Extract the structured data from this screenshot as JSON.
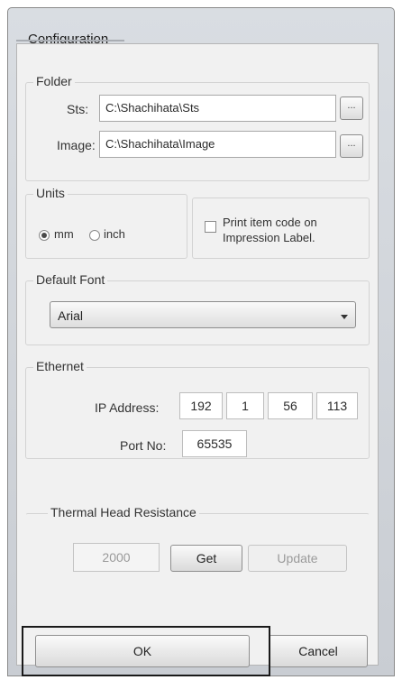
{
  "window": {
    "title": "Configuration"
  },
  "folder": {
    "legend": "Folder",
    "sts_label": "Sts:",
    "sts_value": "C:\\Shachihata\\Sts",
    "image_label": "Image:",
    "image_value": "C:\\Shachihata\\Image",
    "browse_label": "..."
  },
  "units": {
    "legend": "Units",
    "options": [
      {
        "label": "mm",
        "selected": true
      },
      {
        "label": "inch",
        "selected": false
      }
    ]
  },
  "print_item": {
    "label_line1": "Print item code on",
    "label_line2": "Impression Label.",
    "checked": false
  },
  "default_font": {
    "legend": "Default Font",
    "selected": "Arial"
  },
  "ethernet": {
    "legend": "Ethernet",
    "ip_label": "IP Address:",
    "ip": [
      "192",
      "1",
      "56",
      "113"
    ],
    "port_label": "Port No:",
    "port": "65535"
  },
  "thermal": {
    "legend": "Thermal Head Resistance",
    "value": "2000",
    "get_label": "Get",
    "update_label": "Update"
  },
  "buttons": {
    "ok": "OK",
    "cancel": "Cancel"
  }
}
